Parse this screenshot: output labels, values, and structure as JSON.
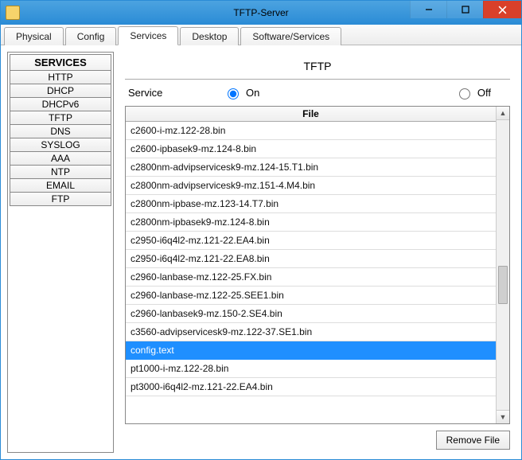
{
  "window": {
    "title": "TFTP-Server"
  },
  "tabs": [
    {
      "label": "Physical",
      "active": false
    },
    {
      "label": "Config",
      "active": false
    },
    {
      "label": "Services",
      "active": true
    },
    {
      "label": "Desktop",
      "active": false
    },
    {
      "label": "Software/Services",
      "active": false
    }
  ],
  "sidebar": {
    "header": "SERVICES",
    "items": [
      {
        "label": "HTTP"
      },
      {
        "label": "DHCP"
      },
      {
        "label": "DHCPv6"
      },
      {
        "label": "TFTP"
      },
      {
        "label": "DNS"
      },
      {
        "label": "SYSLOG"
      },
      {
        "label": "AAA"
      },
      {
        "label": "NTP"
      },
      {
        "label": "EMAIL"
      },
      {
        "label": "FTP"
      }
    ]
  },
  "panel": {
    "title": "TFTP",
    "service_label": "Service",
    "on_label": "On",
    "off_label": "Off",
    "service_on": true,
    "column_header": "File"
  },
  "files": [
    {
      "name": "c2600-i-mz.122-28.bin",
      "selected": false
    },
    {
      "name": "c2600-ipbasek9-mz.124-8.bin",
      "selected": false
    },
    {
      "name": "c2800nm-advipservicesk9-mz.124-15.T1.bin",
      "selected": false
    },
    {
      "name": "c2800nm-advipservicesk9-mz.151-4.M4.bin",
      "selected": false
    },
    {
      "name": "c2800nm-ipbase-mz.123-14.T7.bin",
      "selected": false
    },
    {
      "name": "c2800nm-ipbasek9-mz.124-8.bin",
      "selected": false
    },
    {
      "name": "c2950-i6q4l2-mz.121-22.EA4.bin",
      "selected": false
    },
    {
      "name": "c2950-i6q4l2-mz.121-22.EA8.bin",
      "selected": false
    },
    {
      "name": "c2960-lanbase-mz.122-25.FX.bin",
      "selected": false
    },
    {
      "name": "c2960-lanbase-mz.122-25.SEE1.bin",
      "selected": false
    },
    {
      "name": "c2960-lanbasek9-mz.150-2.SE4.bin",
      "selected": false
    },
    {
      "name": "c3560-advipservicesk9-mz.122-37.SE1.bin",
      "selected": false
    },
    {
      "name": "config.text",
      "selected": true
    },
    {
      "name": "pt1000-i-mz.122-28.bin",
      "selected": false
    },
    {
      "name": "pt3000-i6q4l2-mz.121-22.EA4.bin",
      "selected": false
    }
  ],
  "buttons": {
    "remove_file": "Remove File"
  }
}
